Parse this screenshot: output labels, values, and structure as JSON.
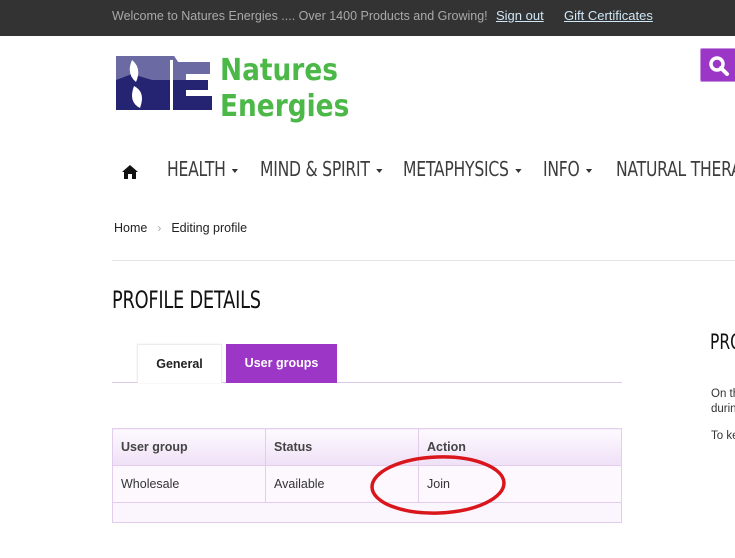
{
  "topbar": {
    "welcome": "Welcome to Natures Energies .... Over 1400 Products and Growing!",
    "sign_out": "Sign out",
    "gift_certificates": "Gift Certificates"
  },
  "logo": {
    "monogram": "NE",
    "line1": "Natures",
    "line2": "Energies"
  },
  "search": {
    "icon": "search-icon"
  },
  "nav": {
    "home_icon": "home-icon",
    "items": [
      {
        "label": "HEALTH",
        "has_dropdown": true
      },
      {
        "label": "MIND & SPIRIT",
        "has_dropdown": true
      },
      {
        "label": "METAPHYSICS",
        "has_dropdown": true
      },
      {
        "label": "INFO",
        "has_dropdown": true
      },
      {
        "label": "NATURAL THERAP",
        "has_dropdown": false
      }
    ]
  },
  "breadcrumb": {
    "home": "Home",
    "separator": "›",
    "current": "Editing profile"
  },
  "page": {
    "title": "PROFILE DETAILS"
  },
  "tabs": [
    {
      "label": "General",
      "active": false
    },
    {
      "label": "User groups",
      "active": true
    }
  ],
  "table": {
    "headers": [
      "User group",
      "Status",
      "Action"
    ],
    "rows": [
      {
        "group": "Wholesale",
        "status": "Available",
        "action": "Join"
      }
    ]
  },
  "sidebar": {
    "title": "PRO",
    "line1": "On th",
    "line2": "durin",
    "line3": "To ke"
  },
  "colors": {
    "accent": "#9c36c6",
    "topbar_bg": "#333333",
    "annotation": "#d9161c",
    "logo_green": "#4bb848",
    "logo_navy": "#242473"
  }
}
